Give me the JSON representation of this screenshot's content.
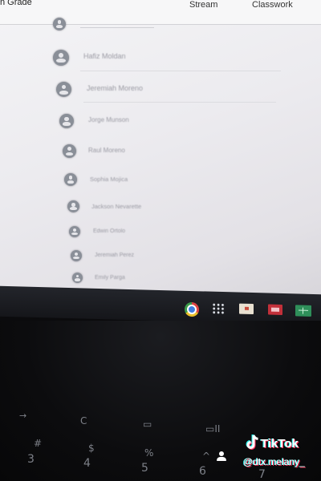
{
  "header": {
    "class_title": "n Grade",
    "tabs": [
      {
        "label": "Stream"
      },
      {
        "label": "Classwork"
      }
    ]
  },
  "students": [
    {
      "name": "Hafiz Moldan"
    },
    {
      "name": "Jeremiah Moreno"
    },
    {
      "name": "Jorge Munson"
    },
    {
      "name": "Raul Moreno"
    },
    {
      "name": "Sophia Mojica"
    },
    {
      "name": "Jackson Nevarette"
    },
    {
      "name": "Edwin Ortolo"
    },
    {
      "name": "Jeremiah Perez"
    },
    {
      "name": "Emily Parga"
    }
  ],
  "taskbar": {
    "icons": [
      "chrome-icon",
      "apps-icon",
      "files-icon",
      "slides-icon",
      "sheets-icon"
    ]
  },
  "keyboard": {
    "keys": [
      {
        "label": "→"
      },
      {
        "label": "C"
      },
      {
        "label": "▭"
      },
      {
        "label": "▭II"
      },
      {
        "label": "#"
      },
      {
        "label": "3"
      },
      {
        "label": "$"
      },
      {
        "label": "4"
      },
      {
        "label": "%"
      },
      {
        "label": "5"
      },
      {
        "label": "^"
      },
      {
        "label": "6"
      },
      {
        "label": "7"
      }
    ]
  },
  "overlay": {
    "brand": "TikTok",
    "handle": "@dtx.melany_"
  },
  "colors": {
    "tiktok_cyan": "#25f4ee",
    "tiktok_red": "#fe2c55"
  }
}
